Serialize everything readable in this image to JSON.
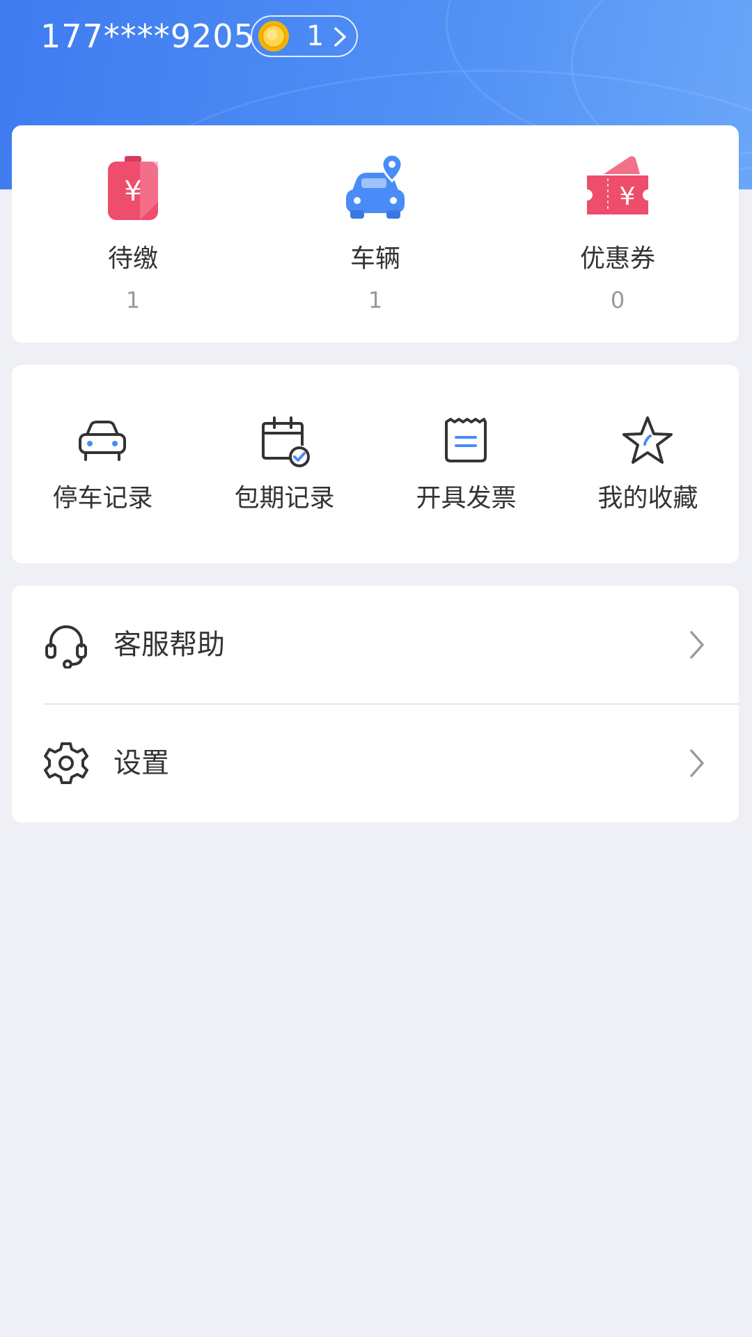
{
  "header": {
    "phone": "177****9205",
    "coins": "1"
  },
  "stats": [
    {
      "label": "待缴",
      "value": "1",
      "icon": "bill-yuan-icon"
    },
    {
      "label": "车辆",
      "value": "1",
      "icon": "car-location-icon"
    },
    {
      "label": "优惠券",
      "value": "0",
      "icon": "coupon-icon"
    }
  ],
  "quick_actions": [
    {
      "label": "停车记录",
      "icon": "car-icon"
    },
    {
      "label": "包期记录",
      "icon": "calendar-check-icon"
    },
    {
      "label": "开具发票",
      "icon": "invoice-icon"
    },
    {
      "label": "我的收藏",
      "icon": "star-icon"
    }
  ],
  "menu": [
    {
      "label": "客服帮助",
      "icon": "headset-icon"
    },
    {
      "label": "设置",
      "icon": "gear-icon"
    }
  ],
  "colors": {
    "header_blue": "#4285f4",
    "accent_blue": "#4a8cf7",
    "pink": "#ee4d6c",
    "background": "#eef0f5"
  }
}
